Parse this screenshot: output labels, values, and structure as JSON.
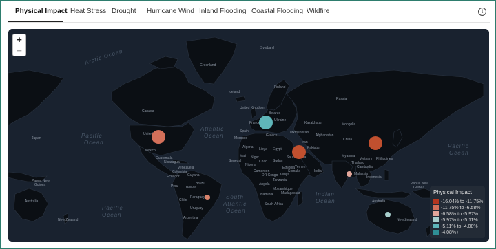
{
  "tabs": [
    {
      "label": "Physical Impact"
    },
    {
      "label": "Heat Stress"
    },
    {
      "label": "Drought"
    },
    {
      "label": "Hurricane Wind"
    },
    {
      "label": "Inland Flooding"
    },
    {
      "label": "Coastal Flooding"
    },
    {
      "label": "Wildfire"
    }
  ],
  "active_tab": "Physical Impact",
  "info_icon": "info-icon",
  "zoom": {
    "in_label": "+",
    "out_label": "−"
  },
  "oceans": {
    "arctic": "Arctic Ocean",
    "pacific_l1": "Pacific",
    "pacific_l2": "Ocean",
    "atlantic_l1": "Atlantic",
    "atlantic_l2": "Ocean",
    "south_atlantic_l1": "South",
    "south_atlantic_l2": "Atlantic",
    "south_atlantic_l3": "Ocean",
    "indian_l1": "Indian",
    "indian_l2": "Ocean",
    "south_pacific_l1": "Pacific",
    "south_pacific_l2": "Ocean",
    "east_pacific_l1": "Pacific",
    "east_pacific_l2": "Ocean"
  },
  "places": {
    "svalbard": "Svalbard",
    "greenland": "Greenland",
    "iceland": "Iceland",
    "russia": "Russia",
    "canada": "Canada",
    "united": "United",
    "mexico": "Mexico",
    "japan": "Japan",
    "kazakhstan": "Kazakhstan",
    "mongolia": "Mongolia",
    "china": "China",
    "india": "India",
    "iran": "Iran",
    "pakistan": "Pakistan",
    "turkmenistan": "Turkmenistan",
    "belarus": "Belarus",
    "ukraine": "Ukraine",
    "france": "France",
    "spain": "Spain",
    "greece": "Greece",
    "algeria": "Algeria",
    "libya": "Libya",
    "egypt": "Egypt",
    "mali": "Mali",
    "niger": "Niger",
    "chad": "Chad",
    "sudan": "Sudan",
    "ethiopia": "Ethiopia",
    "senegal": "Senegal",
    "nigeria": "Nigeria",
    "cameroon": "Cameroon",
    "kenya": "Kenya",
    "tanzania": "Tanzania",
    "angola": "Angola",
    "namibia": "Namibia",
    "south_africa": "South Africa",
    "madagascar": "Madagascar",
    "yemen": "Yemen",
    "venezuela": "Venezuela",
    "colombia": "Colombia",
    "ecuador": "Ecuador",
    "peru": "Peru",
    "bolivia": "Bolivia",
    "brazil": "Brazil",
    "chile": "Chile",
    "uruguay": "Uruguay",
    "argentina": "Argentina",
    "thailand": "Thailand",
    "cambodia": "Cambodia",
    "malaysia": "Malaysia",
    "indonesia": "Indonesia",
    "papua1": "Papua New",
    "papua2": "Guinea",
    "papua3": "Papua New",
    "papua4": "Guinea",
    "australia": "Australia",
    "australia2": "Australia",
    "new_zealand": "New Zealand",
    "new_zealand2": "New Zealand",
    "united_kingdom": "United Kingdom",
    "morocco": "Morocco",
    "guatemala": "Guatemala",
    "nicaragua": "Nicaragua",
    "philippines": "Philippines",
    "finland": "Finland",
    "saudi": "Saudi Arabia",
    "drc": "DR Congo",
    "mozambique": "Mozambique",
    "somalia": "Somalia",
    "afghanistan": "Afghanistan",
    "myanmar": "Myanmar",
    "vietnam": "Vietnam",
    "paraguay": "Paraguay",
    "guyana": "Guyana"
  },
  "markers": [
    {
      "name": "usa",
      "value_bucket": "-11.75% to -6.58%",
      "color": "#d4705a"
    },
    {
      "name": "europe",
      "value_bucket": "-5.11% to -4.08%",
      "color": "#5fb6ba"
    },
    {
      "name": "middle-east",
      "value_bucket": "-16.04% to -11.75%",
      "color": "#c1502f"
    },
    {
      "name": "east-asia",
      "value_bucket": "-16.04% to -11.75%",
      "color": "#c1502f"
    },
    {
      "name": "india",
      "value_bucket": "-6.58% to -5.97%",
      "color": "#e3a69a"
    },
    {
      "name": "brazil",
      "value_bucket": "-11.75% to -6.58%",
      "color": "#d9826b"
    },
    {
      "name": "australia",
      "value_bucket": "-5.97% to -5.11%",
      "color": "#a8cfcd"
    }
  ],
  "legend": {
    "title": "Physical Impact",
    "items": [
      {
        "label": "-16.04% to -11.75%",
        "color": "#b5361f"
      },
      {
        "label": "-11.75% to -6.58%",
        "color": "#d4705a"
      },
      {
        "label": "-6.58% to -5.97%",
        "color": "#e3a69a"
      },
      {
        "label": "-5.97% to -5.11%",
        "color": "#a8cfcd"
      },
      {
        "label": "-5.11% to -4.08%",
        "color": "#5fb6ba"
      },
      {
        "label": "-4.08%+",
        "color": "#2f8f96"
      }
    ]
  },
  "colors": {
    "map_bg": "#19222f",
    "land": "#0b0f14",
    "border": "#2a3340",
    "frame": "#2e7d6e"
  }
}
